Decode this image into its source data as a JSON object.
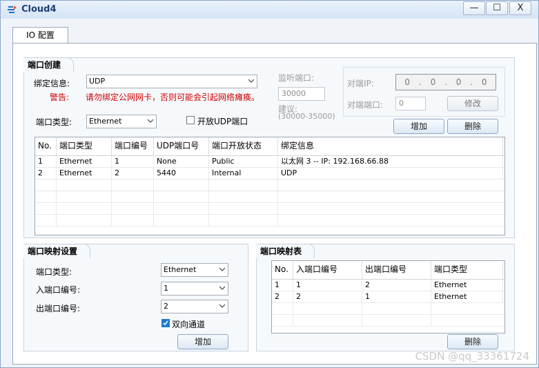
{
  "window": {
    "title": "Cloud4",
    "minimize": "—",
    "maximize": "☐",
    "close": "X"
  },
  "tab": {
    "label": "IO 配置"
  },
  "port_create": {
    "title": "端口创建",
    "bind_label": "绑定信息:",
    "bind_value": "UDP",
    "warning_label": "警告:",
    "warning_text": "请勿绑定公网网卡，否则可能会引起网络瘫痪。",
    "port_type_label": "端口类型:",
    "port_type_value": "Ethernet",
    "open_udp_label": "开放UDP端口",
    "listen_label": "监听端口:",
    "listen_value": "30000",
    "suggest_label": "建议:",
    "suggest_range": "(30000-35000)",
    "peer_ip_label": "对端IP:",
    "peer_ip": [
      "0",
      ".",
      "0",
      ".",
      "0",
      ".",
      "0"
    ],
    "peer_port_label": "对端端口:",
    "peer_port_value": "0",
    "modify_button": "修改",
    "add_button": "增加",
    "delete_button": "删除",
    "table": {
      "headers": [
        "No.",
        "端口类型",
        "端口编号",
        "UDP端口号",
        "端口开放状态",
        "绑定信息"
      ],
      "rows": [
        [
          "1",
          "Ethernet",
          "1",
          "None",
          "Public",
          "以太网 3 -- IP: 192.168.66.88"
        ],
        [
          "2",
          "Ethernet",
          "2",
          "5440",
          "Internal",
          "UDP"
        ]
      ]
    }
  },
  "port_map_settings": {
    "title": "端口映射设置",
    "type_label": "端口类型:",
    "type_value": "Ethernet",
    "in_label": "入端口编号:",
    "in_value": "1",
    "out_label": "出端口编号:",
    "out_value": "2",
    "bidir_label": "双向通道",
    "add_button": "增加"
  },
  "port_map_table": {
    "title": "端口映射表",
    "headers": [
      "No.",
      "入端口编号",
      "出端口编号",
      "端口类型"
    ],
    "rows": [
      [
        "1",
        "1",
        "2",
        "Ethernet"
      ],
      [
        "2",
        "2",
        "1",
        "Ethernet"
      ]
    ],
    "delete_button": "删除"
  },
  "watermark": "CSDN @qq_33361724"
}
